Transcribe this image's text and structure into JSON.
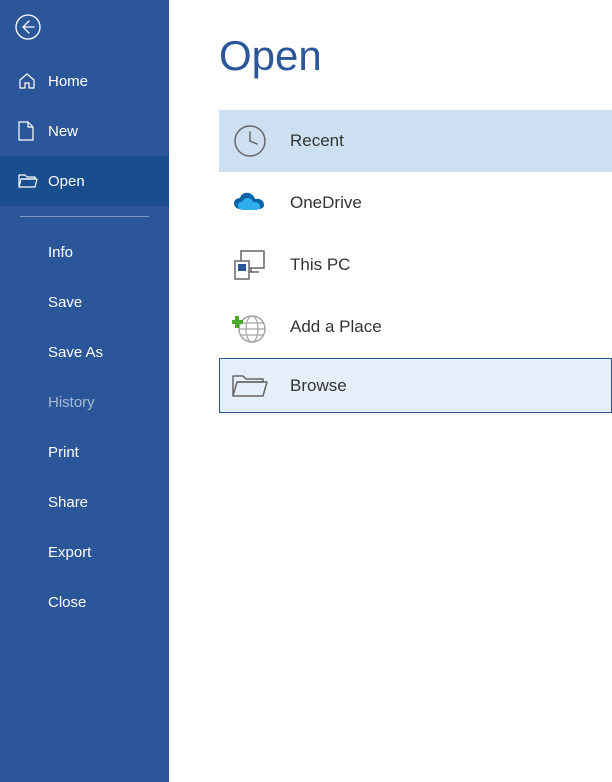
{
  "sidebar": {
    "nav_primary": [
      {
        "label": "Home",
        "icon": "home"
      },
      {
        "label": "New",
        "icon": "new-document"
      },
      {
        "label": "Open",
        "icon": "open-folder",
        "selected": true
      }
    ],
    "nav_secondary": [
      {
        "label": "Info"
      },
      {
        "label": "Save"
      },
      {
        "label": "Save As"
      },
      {
        "label": "History",
        "disabled": true
      },
      {
        "label": "Print"
      },
      {
        "label": "Share"
      },
      {
        "label": "Export"
      },
      {
        "label": "Close"
      }
    ]
  },
  "main": {
    "title": "Open",
    "locations": [
      {
        "label": "Recent",
        "icon": "clock",
        "selected": true
      },
      {
        "label": "OneDrive",
        "icon": "onedrive"
      },
      {
        "label": "This PC",
        "icon": "this-pc"
      },
      {
        "label": "Add a Place",
        "icon": "add-place"
      },
      {
        "label": "Browse",
        "icon": "browse-folder",
        "focused": true
      }
    ]
  },
  "colors": {
    "accent": "#2b579a",
    "selected_light": "#cde0f2",
    "focus_light": "#e5eff9"
  }
}
